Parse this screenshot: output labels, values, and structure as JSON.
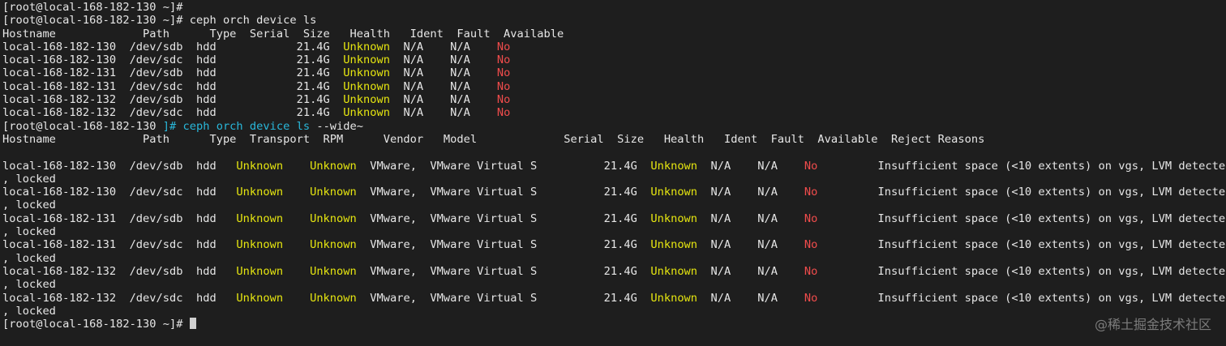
{
  "terminal": {
    "lines": [
      "[root@local-168-182-130 ~]#",
      "[root@local-168-182-130 ~]# ceph orch device ls",
      "Hostname             Path      Type  Serial  Size   Health   Ident  Fault  Available",
      "local-168-182-130  /dev/sdb  hdd            21.4G  |Unknown|  N/A    N/A    ^No^",
      "local-168-182-130  /dev/sdc  hdd            21.4G  |Unknown|  N/A    N/A    ^No^",
      "local-168-182-131  /dev/sdb  hdd            21.4G  |Unknown|  N/A    N/A    ^No^",
      "local-168-182-131  /dev/sdc  hdd            21.4G  |Unknown|  N/A    N/A    ^No^",
      "local-168-182-132  /dev/sdb  hdd            21.4G  |Unknown|  N/A    N/A    ^No^",
      "local-168-182-132  /dev/sdc  hdd            21.4G  |Unknown|  N/A    N/A    ^No^",
      "[root@local-168-182-130 ~]# ceph orch device ls ~--wide~",
      "Hostname             Path      Type  Transport  RPM      Vendor   Model             Serial  Size   Health   Ident  Fault  Available  Reject Reasons",
      "",
      "local-168-182-130  /dev/sdb  hdd   |Unknown|    |Unknown|  VMware,  VMware Virtual S          21.4G  |Unknown|  N/A    N/A    ^No^         Insufficient space (<10 extents) on vgs, LVM detected",
      ", locked",
      "local-168-182-130  /dev/sdc  hdd   |Unknown|    |Unknown|  VMware,  VMware Virtual S          21.4G  |Unknown|  N/A    N/A    ^No^         Insufficient space (<10 extents) on vgs, LVM detected",
      ", locked",
      "local-168-182-131  /dev/sdb  hdd   |Unknown|    |Unknown|  VMware,  VMware Virtual S          21.4G  |Unknown|  N/A    N/A    ^No^         Insufficient space (<10 extents) on vgs, LVM detected",
      ", locked",
      "local-168-182-131  /dev/sdc  hdd   |Unknown|    |Unknown|  VMware,  VMware Virtual S          21.4G  |Unknown|  N/A    N/A    ^No^         Insufficient space (<10 extents) on vgs, LVM detected",
      ", locked",
      "local-168-182-132  /dev/sdb  hdd   |Unknown|    |Unknown|  VMware,  VMware Virtual S          21.4G  |Unknown|  N/A    N/A    ^No^         Insufficient space (<10 extents) on vgs, LVM detected",
      ", locked",
      "local-168-182-132  /dev/sdc  hdd   |Unknown|    |Unknown|  VMware,  VMware Virtual S          21.4G  |Unknown|  N/A    N/A    ^No^         Insufficient space (<10 extents) on vgs, LVM detected",
      ", locked",
      "[root@local-168-182-130 ~]# "
    ],
    "colors": {
      "background": "#1e1e1e",
      "foreground": "#e6e6e6",
      "yellow": "#e5e510",
      "red": "#f14c4c",
      "cyan": "#29b8db"
    }
  },
  "watermark": "@稀土掘金技术社区"
}
